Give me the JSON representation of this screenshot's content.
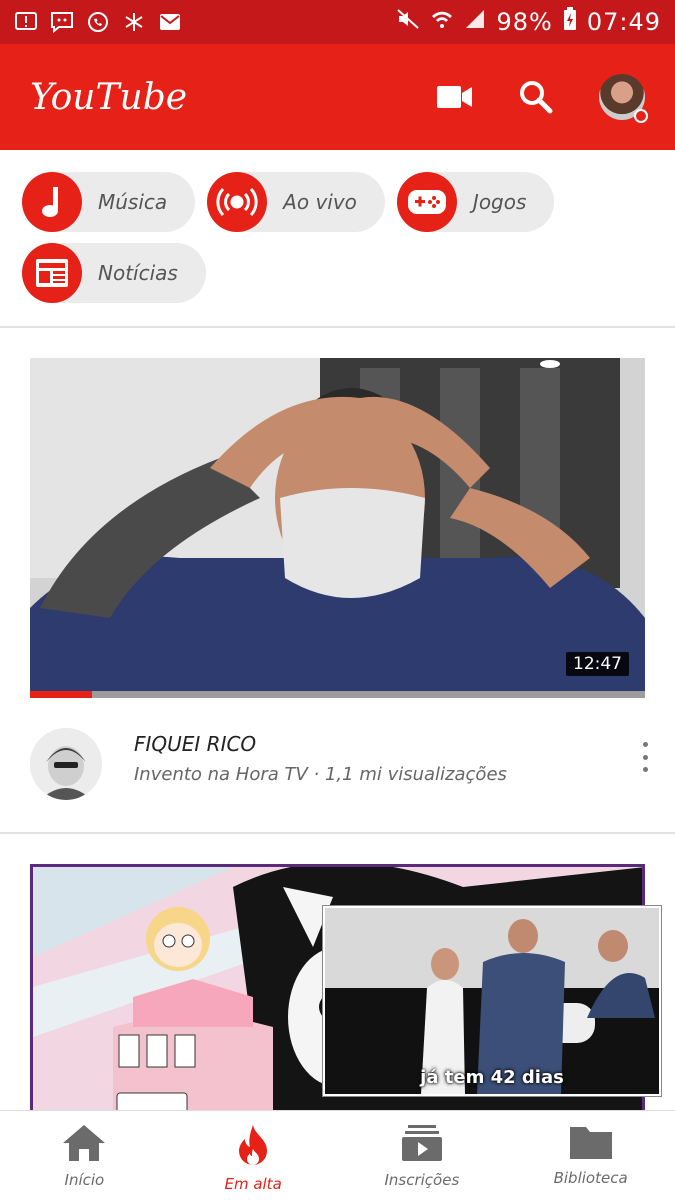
{
  "status_bar": {
    "battery": "98%",
    "time": "07:49",
    "left_icons": [
      "alert-icon",
      "chat-alert-icon",
      "whatsapp-icon",
      "snowflake-icon",
      "mail-icon"
    ],
    "right_icons": [
      "mute-icon",
      "wifi-icon",
      "signal-icon",
      "battery-charging-icon"
    ]
  },
  "app_bar": {
    "title": "YouTube",
    "icons": [
      "camera-icon",
      "search-icon",
      "account-avatar"
    ]
  },
  "chips": [
    {
      "label": "Música",
      "icon": "music-note-icon"
    },
    {
      "label": "Ao vivo",
      "icon": "live-broadcast-icon"
    },
    {
      "label": "Jogos",
      "icon": "gamepad-icon"
    },
    {
      "label": "Notícias",
      "icon": "newspaper-icon"
    }
  ],
  "videos": [
    {
      "title": "FIQUEI RICO",
      "subtitle": "Invento na Hora TV · 1,1 mi visualizações",
      "duration": "12:47",
      "progress": 0.1
    }
  ],
  "mini_player": {
    "caption": "já tem 42 dias"
  },
  "bottom_nav": [
    {
      "label": "Início",
      "icon": "home-icon",
      "active": false
    },
    {
      "label": "Em alta",
      "icon": "flame-icon",
      "active": true
    },
    {
      "label": "Inscrições",
      "icon": "subscriptions-icon",
      "active": false
    },
    {
      "label": "Biblioteca",
      "icon": "folder-icon",
      "active": false
    }
  ],
  "colors": {
    "brand_red": "#e62117",
    "status_red": "#c4181a",
    "chip_bg": "#ebebeb"
  }
}
